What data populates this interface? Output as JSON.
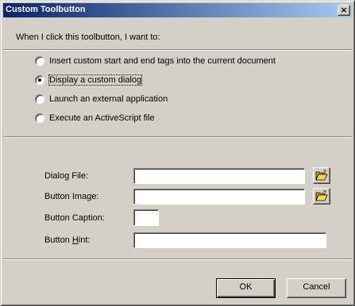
{
  "titlebar": {
    "title": "Custom Toolbutton",
    "close_glyph": "×"
  },
  "prompt": "When I click this toolbutton, I want to:",
  "options": [
    {
      "label": "Insert custom start and end tags into the current document",
      "selected": false
    },
    {
      "label": "Display a custom dialog",
      "selected": true
    },
    {
      "label": "Launch an external application",
      "selected": false
    },
    {
      "label": "Execute an ActiveScript file",
      "selected": false
    }
  ],
  "fields": {
    "dialog_file": {
      "label": "Dialog File:",
      "value": "",
      "browse_icon": "open-folder-icon"
    },
    "button_image": {
      "label": "Button Image:",
      "value": "",
      "browse_icon": "open-folder-icon"
    },
    "button_caption": {
      "label": "Button Caption:",
      "value": ""
    },
    "button_hint": {
      "label_before": "Button ",
      "label_mnemonic": "H",
      "label_after": "int:",
      "value": ""
    }
  },
  "buttons": {
    "ok": "OK",
    "cancel": "Cancel"
  },
  "colors": {
    "face": "#d4d0c8",
    "title_start": "#0a246a",
    "title_end": "#a6caf0",
    "folder": "#ffd34f"
  }
}
